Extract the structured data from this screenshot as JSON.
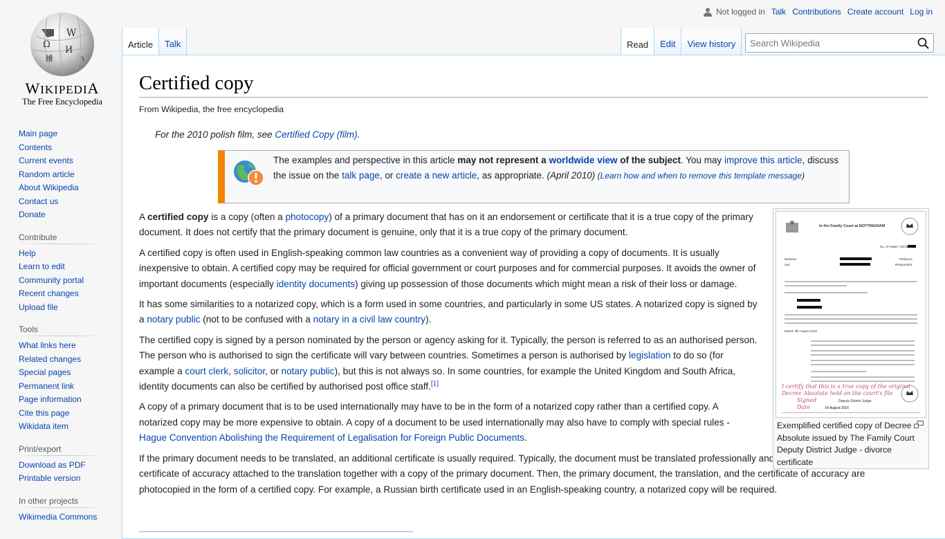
{
  "logo": {
    "wordmark": "Wikipedia",
    "wordmark_display_big": "W",
    "wordmark_display_rest": "IKIPEDI",
    "wordmark_display_end": "A",
    "tagline": "The Free Encyclopedia"
  },
  "personal_tools": {
    "status": "Not logged in",
    "items": [
      "Talk",
      "Contributions",
      "Create account",
      "Log in"
    ]
  },
  "namespace_tabs": [
    {
      "label": "Article",
      "selected": true
    },
    {
      "label": "Talk",
      "selected": false
    }
  ],
  "view_tabs": [
    {
      "label": "Read",
      "selected": true
    },
    {
      "label": "Edit",
      "selected": false
    },
    {
      "label": "View history",
      "selected": false
    }
  ],
  "search": {
    "placeholder": "Search Wikipedia",
    "value": ""
  },
  "sidebar": {
    "navigation": [
      "Main page",
      "Contents",
      "Current events",
      "Random article",
      "About Wikipedia",
      "Contact us",
      "Donate"
    ],
    "contribute": {
      "heading": "Contribute",
      "items": [
        "Help",
        "Learn to edit",
        "Community portal",
        "Recent changes",
        "Upload file"
      ]
    },
    "tools": {
      "heading": "Tools",
      "items": [
        "What links here",
        "Related changes",
        "Special pages",
        "Permanent link",
        "Page information",
        "Cite this page",
        "Wikidata item"
      ]
    },
    "print_export": {
      "heading": "Print/export",
      "items": [
        "Download as PDF",
        "Printable version"
      ]
    },
    "other_projects": {
      "heading": "In other projects",
      "items": [
        "Wikimedia Commons"
      ]
    }
  },
  "article": {
    "title": "Certified copy",
    "site_sub": "From Wikipedia, the free encyclopedia",
    "hatnote": {
      "prefix": "For the 2010 polish film, see ",
      "link": "Certified Copy (film)",
      "suffix": "."
    },
    "ambox": {
      "t1": "The examples and perspective in this article ",
      "b1": "may not represent a ",
      "b_link": "worldwide view",
      "b2": " of the subject",
      "t2": ". You may ",
      "link1": "improve this article",
      "t3": ", discuss the issue on the ",
      "link2": "talk page",
      "t4": ", or ",
      "link3": "create a new article",
      "t5": ", as appropriate. ",
      "date": "(April 2010)",
      "t6": " (",
      "learn_link": "Learn how and when to remove this template message",
      "t7": ")",
      "accent_color": "#f28500"
    },
    "paragraphs": {
      "p1": {
        "a": "A ",
        "bold": "certified copy",
        "b": " is a copy (often a ",
        "link1": "photocopy",
        "c": ") of a primary document that has on it an endorsement or certificate that it is a true copy of the primary document. It does not certify that the primary document is genuine, only that it is a true copy of the primary document."
      },
      "p2": {
        "a": "A certified copy is often used in English-speaking common law countries as a convenient way of providing a copy of documents. It is usually inexpensive to obtain. A certified copy may be required for official government or court purposes and for commercial purposes. It avoids the owner of important documents (especially ",
        "link1": "identity documents",
        "b": ") giving up possession of those documents which might mean a risk of their loss or damage."
      },
      "p3": {
        "a": "It has some similarities to a notarized copy, which is a form used in some countries, and particularly in some US states. A notarized copy is signed by a ",
        "link1": "notary public",
        "b": " (not to be confused with a ",
        "link2": "notary in a civil law country",
        "c": ")."
      },
      "p4": {
        "a": "The certified copy is signed by a person nominated by the person or agency asking for it. Typically, the person is referred to as an authorised person. The person who is authorised to sign the certificate will vary between countries. Sometimes a person is authorised by ",
        "link1": "legislation",
        "b": " to do so (for example a ",
        "link2": "court clerk",
        "c": ", ",
        "link3": "solicitor",
        "d": ", or ",
        "link4": "notary public",
        "e": "), but this is not always so. In some countries, for example the United Kingdom and South Africa, identity documents can also be certified by authorised post office staff.",
        "ref": "[1]"
      },
      "p5": {
        "a": "A copy of a primary document that is to be used internationally may have to be in the form of a notarized copy rather than a certified copy. A notarized copy may be more expensive to obtain. A copy of a document to be used internationally may also have to comply with special rules - ",
        "link1": "Hague Convention Abolishing the Requirement of Legalisation for Foreign Public Documents",
        "b": "."
      },
      "p6": {
        "a": "If the primary document needs to be translated, an additional certificate is usually required. Typically, the document must be translated professionally and have the professional's certificate of accuracy attached to the translation together with a copy of the primary document. Then, the primary document, the translation, and the certificate of accuracy are photocopied in the form of a certified copy. For example, a Russian birth certificate used in an English-speaking country, a notarized copy will be required."
      }
    },
    "thumbnail": {
      "caption": "Exemplified certified copy of Decree Absolute issued by The Family Court Deputy District Judge - divorce certificate",
      "image": {
        "court_heading": "In the Family Court at NOTTINGHAM",
        "matter_label": "No. of matter: NG15D0",
        "between": "Between",
        "and": "and",
        "petitioner": "Petitioner",
        "respondent": "Respondent",
        "dated": "Dated: 4th August 2016",
        "handwriting_1": "I certify that this is a true copy of the original",
        "handwriting_2": "Decree Absolute held on the court's file",
        "handwriting_3": "Signed",
        "handwriting_4": "Date",
        "signature_title": "Deputy District Judge",
        "signature_date": "14 August 2016"
      }
    }
  }
}
